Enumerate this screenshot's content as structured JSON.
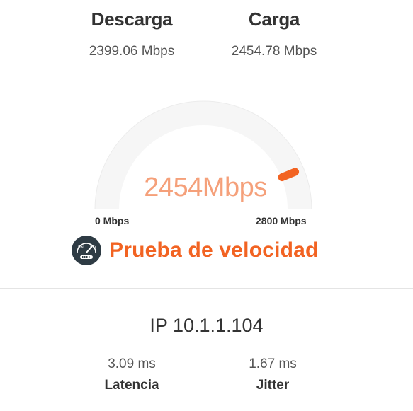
{
  "download": {
    "label": "Descarga",
    "value": "2399.06 Mbps"
  },
  "upload": {
    "label": "Carga",
    "value": "2454.78 Mbps"
  },
  "gauge": {
    "reading": "2454Mbps",
    "min_label": "0 Mbps",
    "max_label": "2800 Mbps",
    "value": 2454,
    "max": 2800,
    "color": "#f26322"
  },
  "brand": {
    "title": "Prueba de velocidad",
    "logo_icon": "speedometer-icon",
    "color": "#f26322"
  },
  "ip": {
    "text": "IP 10.1.1.104"
  },
  "latency": {
    "value": "3.09 ms",
    "label": "Latencia"
  },
  "jitter": {
    "value": "1.67 ms",
    "label": "Jitter"
  }
}
